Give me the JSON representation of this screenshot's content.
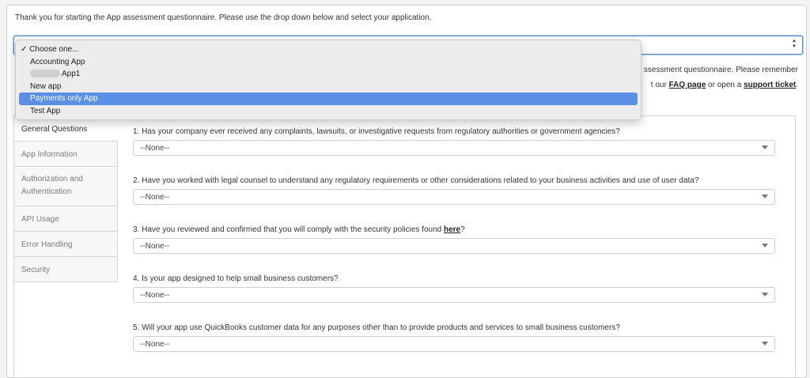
{
  "intro_text": "Thank you for starting the App assessment questionnaire. Please use the drop down below and select your application.",
  "app_select": {
    "options": [
      {
        "label": "Choose one...",
        "checked": true,
        "check_mark": "✓"
      },
      {
        "label": "Accounting App"
      },
      {
        "label": "App1",
        "redacted_prefix": true
      },
      {
        "label": "New app"
      },
      {
        "label": "Payments only App",
        "highlighted": true
      },
      {
        "label": "Test App"
      }
    ],
    "highlight_color": "#5a8fe6"
  },
  "info": {
    "line1": "ssessment questionnaire. Please remember",
    "line2_prefix": "t our ",
    "faq_link": "FAQ page",
    "line2_middle": " or open a ",
    "support_link": "support ticket",
    "line2_suffix": "."
  },
  "sidebar": {
    "items": [
      {
        "label": "General Questions",
        "active": true
      },
      {
        "label": "App Information"
      },
      {
        "label": "Authorization and Authentication"
      },
      {
        "label": "API Usage"
      },
      {
        "label": "Error Handling"
      },
      {
        "label": "Security"
      }
    ]
  },
  "questions": [
    {
      "label": "1. Has your company ever received any complaints, lawsuits, or investigative requests from regulatory authorities or government agencies?",
      "value": "--None--"
    },
    {
      "label": "2. Have you worked with legal counsel to understand any regulatory requirements or other considerations related to your business activities and use of user data?",
      "value": "--None--"
    },
    {
      "label_prefix": "3. Have you reviewed and confirmed that you will comply with the security policies found ",
      "link": "here",
      "label_suffix": "?",
      "value": "--None--"
    },
    {
      "label": "4. Is your app designed to help small business customers?",
      "value": "--None--"
    },
    {
      "label": "5. Will your app use QuickBooks customer data for any purposes other than to provide products and services to small business customers?",
      "value": "--None--"
    }
  ]
}
